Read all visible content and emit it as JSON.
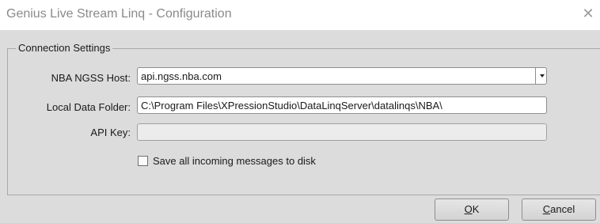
{
  "window": {
    "title": "Genius Live Stream Linq - Configuration",
    "close_glyph": "✕"
  },
  "connection_settings": {
    "legend": "Connection Settings",
    "host": {
      "label": "NBA NGSS Host:",
      "value": "api.ngss.nba.com"
    },
    "folder": {
      "label": "Local Data Folder:",
      "value": "C:\\Program Files\\XPressionStudio\\DataLinqServer\\datalinqs\\NBA\\"
    },
    "api_key": {
      "label": "API Key:",
      "value": ""
    },
    "save_messages": {
      "label": "Save all incoming messages to disk",
      "checked": false
    }
  },
  "buttons": {
    "ok": {
      "mnemonic": "O",
      "rest": "K"
    },
    "cancel": {
      "mnemonic": "C",
      "rest": "ancel"
    }
  }
}
